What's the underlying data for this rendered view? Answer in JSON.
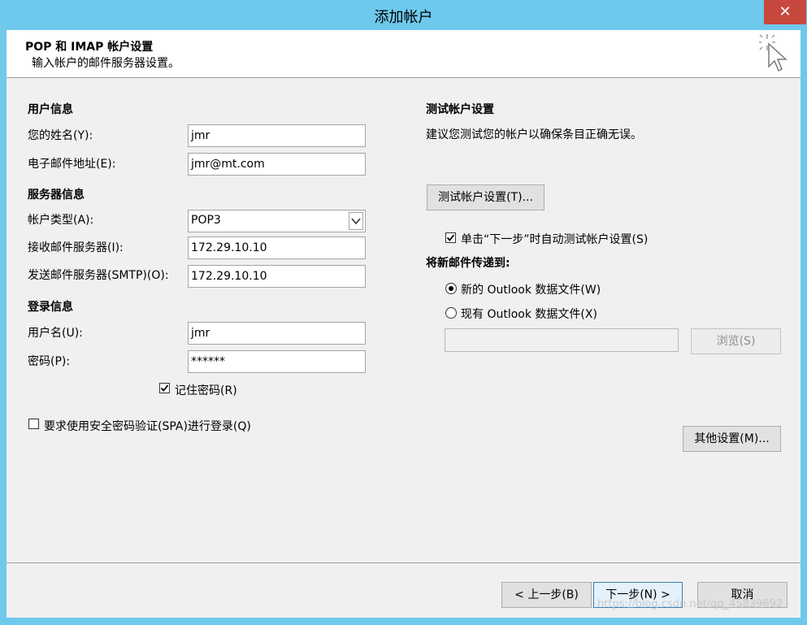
{
  "window": {
    "title": "添加帐户",
    "close_glyph": "✕"
  },
  "header": {
    "title": "POP 和 IMAP 帐户设置",
    "subtitle": "输入帐户的邮件服务器设置。",
    "icon": "wizard-cursor-icon"
  },
  "user_info": {
    "section_label": "用户信息",
    "name_label": "您的姓名(Y):",
    "name_value": "jmr",
    "email_label": "电子邮件地址(E):",
    "email_value": "jmr@mt.com"
  },
  "server_info": {
    "section_label": "服务器信息",
    "account_type_label": "帐户类型(A):",
    "account_type_value": "POP3",
    "incoming_label": "接收邮件服务器(I):",
    "incoming_value": "172.29.10.10",
    "outgoing_label": "发送邮件服务器(SMTP)(O):",
    "outgoing_value": "172.29.10.10"
  },
  "login_info": {
    "section_label": "登录信息",
    "username_label": "用户名(U):",
    "username_value": "jmr",
    "password_label": "密码(P):",
    "password_value": "******",
    "remember_label": "记住密码(R)",
    "remember_checked": true,
    "spa_label": "要求使用安全密码验证(SPA)进行登录(Q)",
    "spa_checked": false
  },
  "test_settings": {
    "section_label": "测试帐户设置",
    "description": "建议您测试您的帐户以确保条目正确无误。",
    "test_button": "测试帐户设置(T)...",
    "auto_test_label": "单击“下一步”时自动测试帐户设置(S)",
    "auto_test_checked": true
  },
  "deliver": {
    "section_label": "将新邮件传递到:",
    "new_file_label": "新的 Outlook 数据文件(W)",
    "existing_file_label": "现有 Outlook 数据文件(X)",
    "selected": "new",
    "path_value": "",
    "browse_button": "浏览(S)"
  },
  "more_settings_button": "其他设置(M)...",
  "footer": {
    "back_button": "< 上一步(B)",
    "next_button": "下一步(N) >",
    "cancel_button": "取消"
  },
  "watermark": "https://blog.csdn.net/qq_45839692"
}
